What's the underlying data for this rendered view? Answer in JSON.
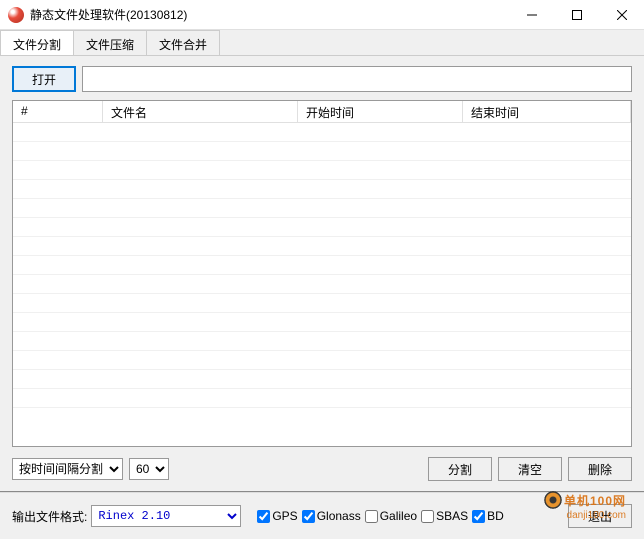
{
  "titlebar": {
    "title": "静态文件处理软件(20130812)"
  },
  "tabs": [
    "文件分割",
    "文件压缩",
    "文件合并"
  ],
  "active_tab": 0,
  "open_button": "打开",
  "open_path": "",
  "table": {
    "columns": [
      "#",
      "文件名",
      "开始时间",
      "结束时间"
    ],
    "rows": []
  },
  "split_mode": {
    "selected": "按时间间隔分割",
    "options": [
      "按时间间隔分割"
    ]
  },
  "interval": {
    "selected": "60",
    "options": [
      "60"
    ]
  },
  "buttons": {
    "split": "分割",
    "clear": "清空",
    "delete": "删除",
    "exit": "退出"
  },
  "footer": {
    "format_label": "输出文件格式:",
    "format_selected": "Rinex 2.10",
    "format_options": [
      "Rinex 2.10"
    ],
    "gnss": [
      {
        "label": "GPS",
        "checked": true
      },
      {
        "label": "Glonass",
        "checked": true
      },
      {
        "label": "Galileo",
        "checked": false
      },
      {
        "label": "SBAS",
        "checked": false
      },
      {
        "label": "BD",
        "checked": true
      }
    ]
  },
  "watermark": {
    "main": "单机100网",
    "sub": "danji100.com"
  }
}
